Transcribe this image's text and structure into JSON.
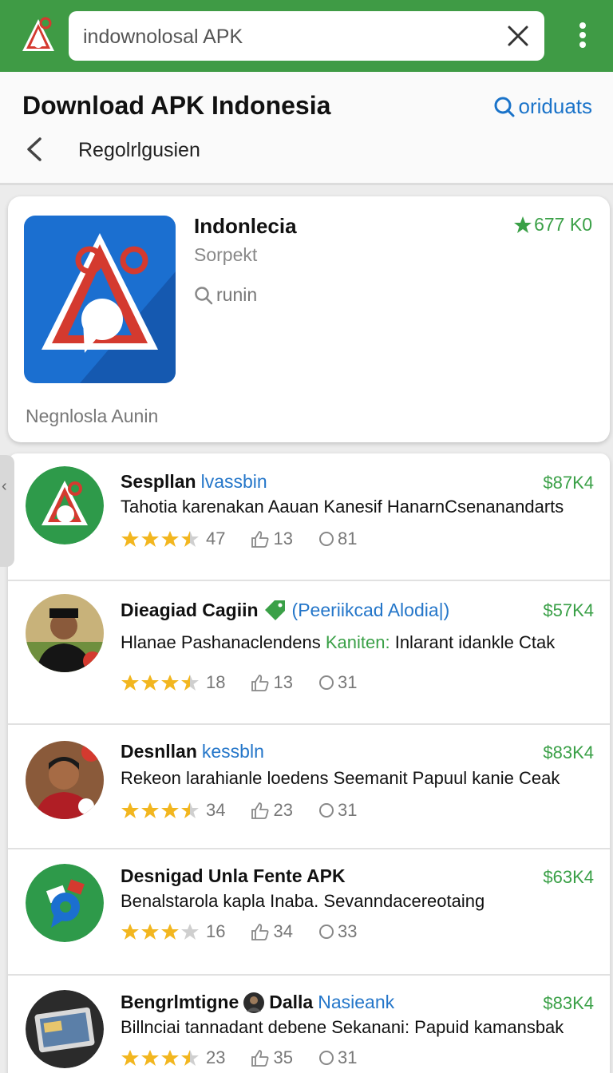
{
  "search": {
    "value": "indownolosal APK"
  },
  "header": {
    "title": "Download APK Indonesia",
    "action_label": "oriduats",
    "subheading": "Regolrlgusien"
  },
  "featured": {
    "name": "Indonlecia",
    "category": "Sorpekt",
    "meta": "runin",
    "downloads": "677 K0",
    "footer": "Negnlosla  Aunin"
  },
  "list": [
    {
      "title": "Sespllan",
      "tag": "lvassbin",
      "price": "$87K4",
      "desc": "Tahotia karenakan Aauan Kanesif HanarnCsenanandarts",
      "desc_highlight": "",
      "rating": 3.5,
      "rating_text": "47",
      "likes": "13",
      "comments": "81"
    },
    {
      "title": "Dieagiad Cagiin",
      "tag": "(Peeriikcad Alodia|)",
      "price": "$57K4",
      "desc": "Hlanae Pashanaclendens ",
      "desc_highlight": "Kaniten:",
      "desc_tail": " Inlarant idankle Ctak",
      "rating": 3.5,
      "rating_text": "18",
      "likes": "13",
      "comments": "31"
    },
    {
      "title": "Desnllan",
      "tag": "kessbln",
      "price": "$83K4",
      "desc": "Rekeon larahianle loedens Seemanit  Papuul kanie Ceak",
      "desc_highlight": "",
      "rating": 3.5,
      "rating_text": "34",
      "likes": "23",
      "comments": "31"
    },
    {
      "title": "Desnigad Unla Fente APK",
      "tag": "",
      "price": "$63K4",
      "desc": "Benalstarola kapla Inaba. Sevanndacereotaing",
      "desc_highlight": "",
      "rating": 3,
      "rating_text": "16",
      "likes": "34",
      "comments": "33"
    },
    {
      "title": "Bengrlmtigne",
      "title2": "Dalla",
      "tag": "Nasieank",
      "price": "$83K4",
      "desc": "Billnciai tannadant debene Sekanani:  Papuid kamansbak",
      "desc_highlight": "",
      "rating": 3.5,
      "rating_text": "23",
      "likes": "35",
      "comments": "31"
    }
  ],
  "colors": {
    "brand_green": "#3f9b45",
    "link_blue": "#1a73c9",
    "accent_green": "#3aa047",
    "star_yellow": "#f2b61f"
  },
  "icons": [
    "app-logo",
    "clear-icon",
    "overflow-menu-icon",
    "search-icon",
    "back-arrow-icon",
    "star-icon",
    "like-icon",
    "comment-icon"
  ]
}
